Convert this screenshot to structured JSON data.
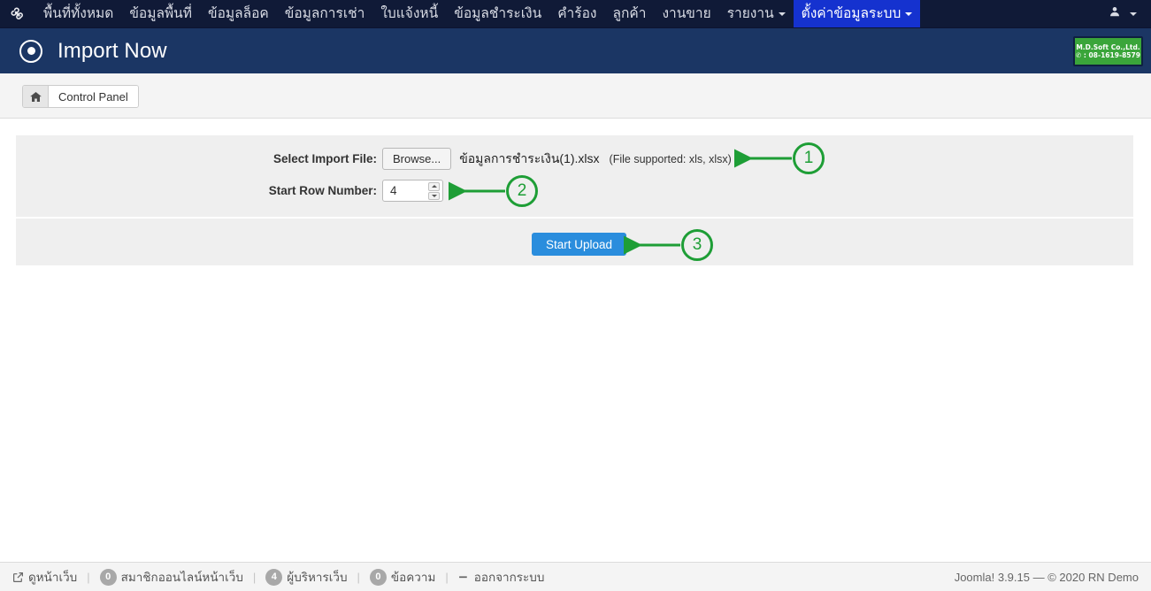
{
  "topnav": {
    "logo_icon": "joomla-logo-icon",
    "items": [
      {
        "label": "พื้นที่ทั้งหมด",
        "active": false,
        "caret": false
      },
      {
        "label": "ข้อมูลพื้นที่",
        "active": false,
        "caret": false
      },
      {
        "label": "ข้อมูลล็อค",
        "active": false,
        "caret": false
      },
      {
        "label": "ข้อมูลการเช่า",
        "active": false,
        "caret": false
      },
      {
        "label": "ใบแจ้งหนี้",
        "active": false,
        "caret": false
      },
      {
        "label": "ข้อมูลชำระเงิน",
        "active": false,
        "caret": false
      },
      {
        "label": "คำร้อง",
        "active": false,
        "caret": false
      },
      {
        "label": "ลูกค้า",
        "active": false,
        "caret": false
      },
      {
        "label": "งานขาย",
        "active": false,
        "caret": false
      },
      {
        "label": "รายงาน",
        "active": false,
        "caret": true
      },
      {
        "label": "ตั้งค่าข้อมูลระบบ",
        "active": true,
        "caret": true
      }
    ],
    "user_icon": "user-icon"
  },
  "header": {
    "title": "Import Now",
    "icon": "target-circle-icon",
    "brand": {
      "line1": "M.D.Soft Co.,Ltd.",
      "line2": "✆ : 08-1619-8579",
      "bg_color": "#3aa53a"
    }
  },
  "breadcrumb": {
    "home_icon": "home-icon",
    "control_panel_label": "Control Panel"
  },
  "form": {
    "file_row": {
      "label": "Select Import File:",
      "browse_label": "Browse...",
      "file_name": "ข้อมูลการชำระเงิน(1).xlsx",
      "supported_note": "(File supported: xls, xlsx)"
    },
    "start_row": {
      "label": "Start Row Number:",
      "value": "4",
      "placeholder": ""
    },
    "submit": {
      "label": "Start Upload",
      "color": "#2a8ddd"
    }
  },
  "annotations": {
    "color": "#1e9e36",
    "markers": [
      {
        "number": "1",
        "target": "file-supported-note"
      },
      {
        "number": "2",
        "target": "start-row-input"
      },
      {
        "number": "3",
        "target": "start-upload-button"
      }
    ]
  },
  "footer": {
    "left_items": [
      {
        "icon": "external-link-icon",
        "badge": null,
        "label": "ดูหน้าเว็บ"
      },
      {
        "icon": null,
        "badge": "0",
        "label": "สมาชิกออนไลน์หน้าเว็บ"
      },
      {
        "icon": null,
        "badge": "4",
        "label": "ผู้บริหารเว็บ"
      },
      {
        "icon": null,
        "badge": "0",
        "label": "ข้อความ"
      },
      {
        "icon": "logout-icon",
        "badge": null,
        "label": "ออกจากระบบ"
      }
    ],
    "separator": "|",
    "right": "Joomla! 3.9.15  —  © 2020 RN Demo"
  }
}
